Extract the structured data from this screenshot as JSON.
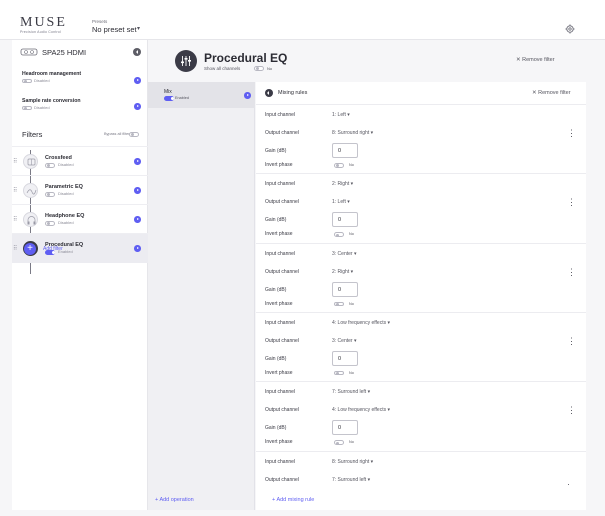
{
  "app": {
    "logo": "MUSE",
    "logo_sub": "Precision Audio Control",
    "presets_label": "Presets",
    "presets_value": "No preset set",
    "settings_icon": "gear-icon"
  },
  "device": {
    "name": "SPA25 HDMI",
    "icon": "speaker-icon"
  },
  "settings": [
    {
      "title": "Headroom management",
      "status": "Disabled"
    },
    {
      "title": "Sample rate conversion",
      "status": "Disabled"
    }
  ],
  "filters": {
    "header": "Filters",
    "bypass_label": "Bypass all filters",
    "items": [
      {
        "name": "Crossfeed",
        "status": "Disabled",
        "enabled": false
      },
      {
        "name": "Parametric EQ",
        "status": "Disabled",
        "enabled": false
      },
      {
        "name": "Headphone EQ",
        "status": "Disabled",
        "enabled": false
      },
      {
        "name": "Procedural EQ",
        "status": "Enabled",
        "enabled": true
      }
    ],
    "add_label": "Add filter"
  },
  "main": {
    "title": "Procedural EQ",
    "show_all_label": "Show all channels",
    "show_all_value": "No",
    "remove_filter": "Remove filter"
  },
  "operations": {
    "items": [
      {
        "name": "Mix",
        "status": "Enabled"
      }
    ],
    "add_label": "Add operation"
  },
  "rules": {
    "title": "Mixing rules",
    "remove_filter": "Remove filter",
    "labels": {
      "input": "Input channel",
      "output": "Output channel",
      "gain": "Gain (dB)",
      "invert": "Invert phase",
      "no": "No"
    },
    "items": [
      {
        "input": "1: Left",
        "output": "8: Surround right",
        "gain": "0"
      },
      {
        "input": "2: Right",
        "output": "1: Left",
        "gain": "0"
      },
      {
        "input": "3: Center",
        "output": "2: Right",
        "gain": "0"
      },
      {
        "input": "4: Low frequency effects",
        "output": "3: Center",
        "gain": "0"
      },
      {
        "input": "7: Surround left",
        "output": "4: Low frequency effects",
        "gain": "0"
      },
      {
        "input": "8: Surround right",
        "output": "7: Surround left",
        "gain": ""
      }
    ],
    "add_label": "Add mixing rule"
  },
  "colors": {
    "accent": "#5f5ef2",
    "icon_dark": "#3b3b47"
  }
}
